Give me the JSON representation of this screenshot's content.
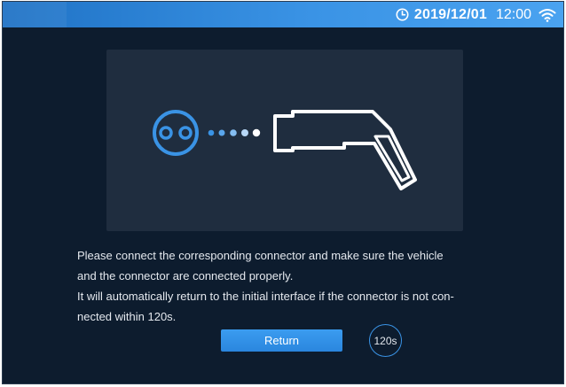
{
  "status_bar": {
    "date": "2019/12/01",
    "time": "12:00",
    "clock_icon": "clock-icon",
    "wifi_icon": "wifi-icon"
  },
  "illustration": {
    "socket_icon": "socket-icon",
    "connector_icon": "charging-connector-icon",
    "dots_count": 5
  },
  "instructions": {
    "line1": "Please connect the corresponding connector and make sure the vehicle",
    "line2": "and the connector are connected properly.",
    "line3": "It will automatically return to the initial interface if the connector is not con-",
    "line4": "nected within 120s."
  },
  "actions": {
    "return_label": "Return",
    "countdown": "120s"
  },
  "colors": {
    "background": "#0d1c2e",
    "panel": "#1f2d3f",
    "accent": "#3a93e5",
    "status_bar": "#2f86d8"
  }
}
